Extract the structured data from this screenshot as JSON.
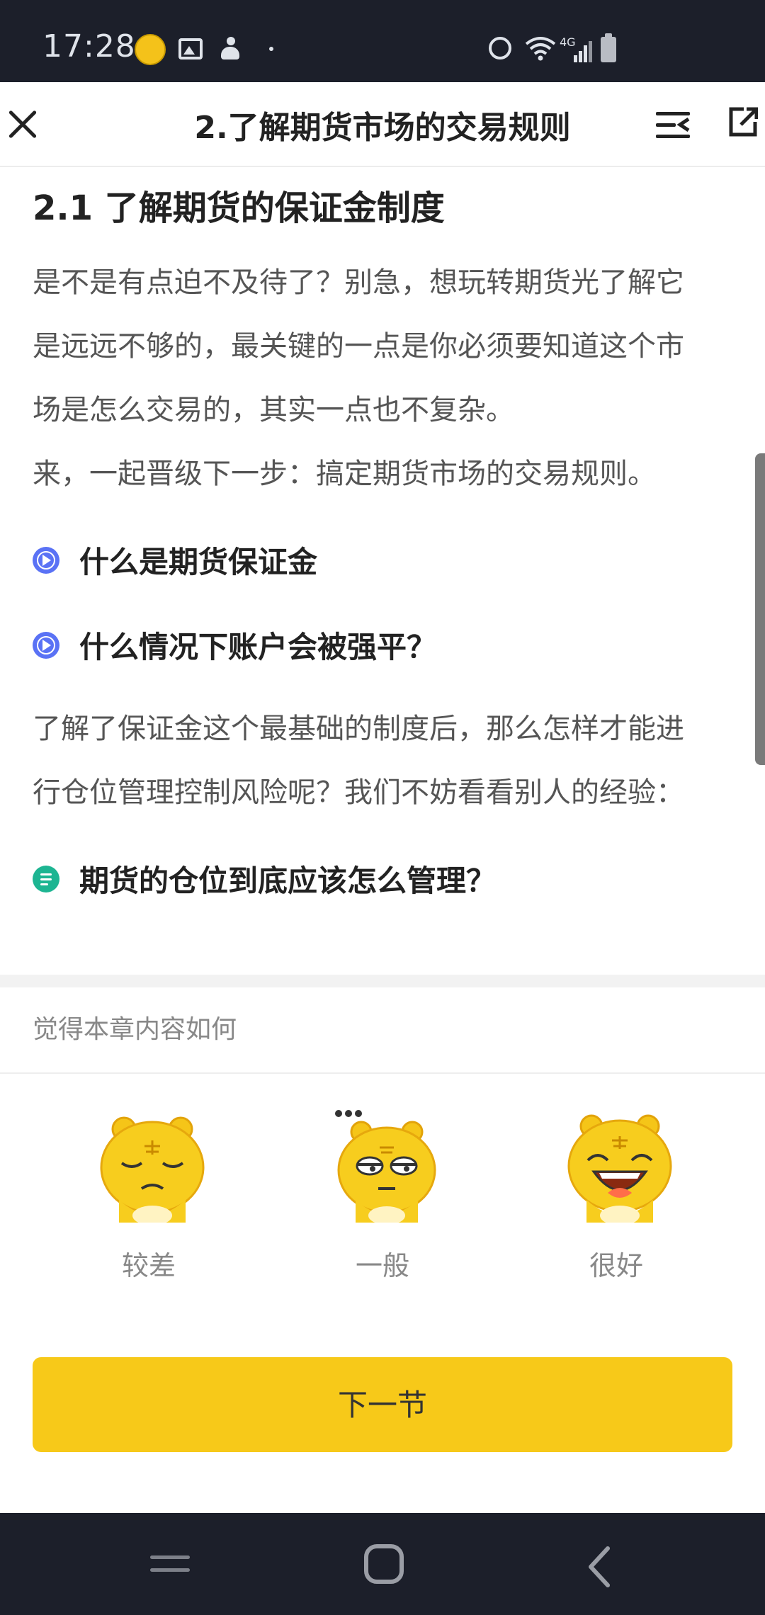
{
  "status_bar": {
    "time": "17:28",
    "network": "4G",
    "icons": [
      "coin-app-icon",
      "gallery-icon",
      "activity-icon",
      "dot-icon",
      "alarm-icon",
      "wifi-icon",
      "signal-icon",
      "battery-icon"
    ]
  },
  "header": {
    "title": "2.了解期货市场的交易规则",
    "icons": [
      "close-icon",
      "menu-icon",
      "share-icon"
    ]
  },
  "content": {
    "section_title": "2.1 了解期货的保证金制度",
    "intro_lines": [
      "是不是有点迫不及待了？别急，想玩转期货光了解它",
      "是远远不够的，最关键的一点是你必须要知道这个市",
      "场是怎么交易的，其实一点也不复杂。",
      "来，一起晋级下一步：搞定期货市场的交易规则。"
    ],
    "links": [
      {
        "label": "什么是期货保证金",
        "icon": "play-icon"
      },
      {
        "label": "什么情况下账户会被强平？",
        "icon": "play-icon"
      }
    ],
    "body_lines": [
      "了解了保证金这个最基础的制度后，那么怎样才能进",
      "行仓位管理控制风险呢？我们不妨看看别人的经验："
    ],
    "article_link": {
      "label": "期货的仓位到底应该怎么管理？",
      "icon": "doc-icon"
    }
  },
  "rating": {
    "title": "觉得本章内容如何",
    "options": [
      {
        "label": "较差",
        "icon": "tiger-sad-icon"
      },
      {
        "label": "一般",
        "icon": "tiger-meh-icon"
      },
      {
        "label": "很好",
        "icon": "tiger-happy-icon"
      }
    ]
  },
  "next_button": {
    "label": "下一节"
  },
  "colors": {
    "accent_button": "#f7c919",
    "play_icon": "#5a72f5",
    "doc_icon": "#1db592",
    "system_bar": "#1c1f2a"
  }
}
